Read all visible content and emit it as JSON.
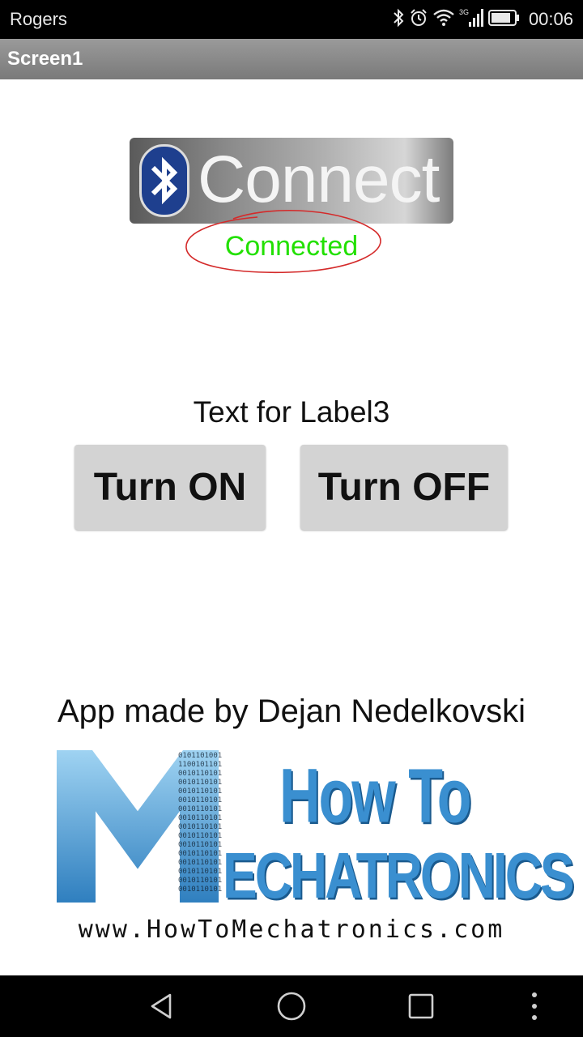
{
  "status_bar": {
    "carrier": "Rogers",
    "network": "3G",
    "clock": "00:06",
    "icons": [
      "bluetooth-icon",
      "alarm-icon",
      "wifi-icon",
      "signal-icon",
      "battery-icon"
    ]
  },
  "title_bar": {
    "title": "Screen1"
  },
  "connect": {
    "label": "Connect",
    "icon": "bluetooth-icon"
  },
  "connection_status": {
    "text": "Connected",
    "color": "#22e000"
  },
  "label3": "Text for Label3",
  "buttons": {
    "on": "Turn ON",
    "off": "Turn OFF"
  },
  "footer": {
    "made_by": "App made by Dejan Nedelkovski",
    "logo_line1": "How To",
    "logo_m": "M",
    "logo_line2": "ECHATRONICS",
    "website": "www.HowToMechatronics.com"
  },
  "nav_bar": {
    "icons": [
      "back-icon",
      "home-icon",
      "recents-icon",
      "menu-icon"
    ]
  },
  "colors": {
    "title_bar": "#888888",
    "button_bg": "#d3d3d3",
    "status_green": "#22e000"
  }
}
